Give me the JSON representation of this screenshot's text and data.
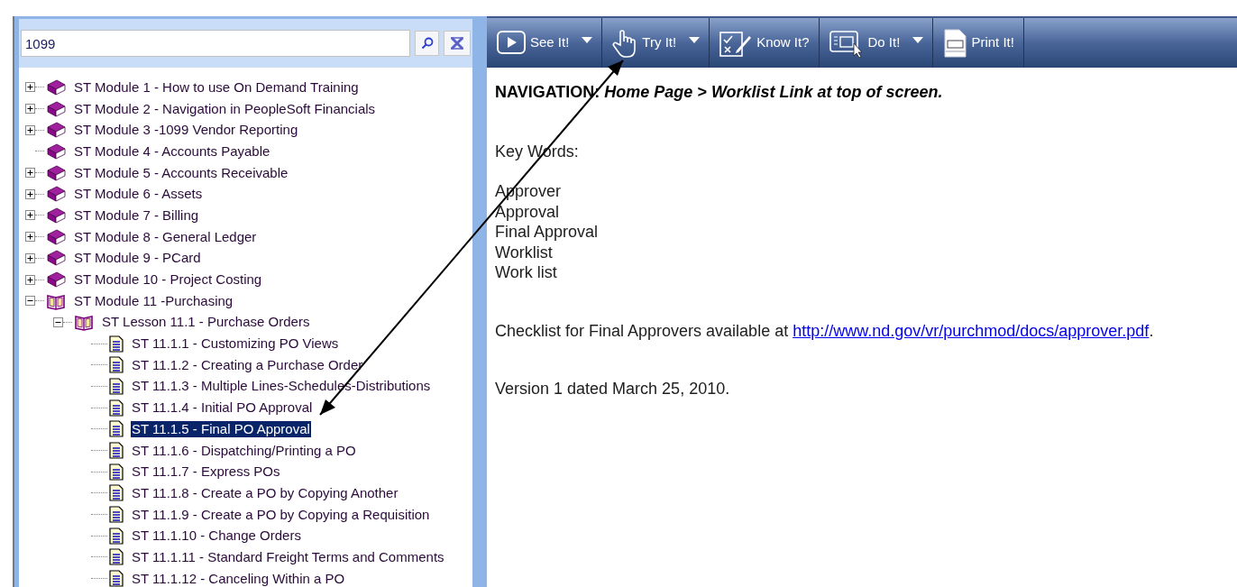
{
  "search": {
    "value": "1099"
  },
  "toolbar": {
    "buttons": [
      {
        "kind": "see",
        "label": "See It!",
        "has_menu": true
      },
      {
        "kind": "try",
        "label": "Try It!",
        "has_menu": true
      },
      {
        "kind": "know",
        "label": "Know It?",
        "has_menu": false
      },
      {
        "kind": "do",
        "label": "Do It!",
        "has_menu": true
      },
      {
        "kind": "print",
        "label": "Print It!",
        "has_menu": false
      }
    ]
  },
  "tree": [
    {
      "kind": "book",
      "label": "ST Module 1 - How to use On Demand Training",
      "expandable": true,
      "expanded": false
    },
    {
      "kind": "book",
      "label": "ST Module 2 - Navigation in PeopleSoft Financials",
      "expandable": true,
      "expanded": false
    },
    {
      "kind": "book",
      "label": "ST Module 3 -1099 Vendor Reporting",
      "expandable": true,
      "expanded": false
    },
    {
      "kind": "book",
      "label": "ST Module 4 - Accounts Payable",
      "expandable": false,
      "expanded": false
    },
    {
      "kind": "book",
      "label": "ST Module 5 - Accounts Receivable",
      "expandable": true,
      "expanded": false
    },
    {
      "kind": "book",
      "label": "ST Module 6 - Assets",
      "expandable": true,
      "expanded": false
    },
    {
      "kind": "book",
      "label": "ST Module 7 - Billing",
      "expandable": true,
      "expanded": false
    },
    {
      "kind": "book",
      "label": "ST Module 8 - General Ledger",
      "expandable": true,
      "expanded": false
    },
    {
      "kind": "book",
      "label": "ST Module 9 - PCard",
      "expandable": true,
      "expanded": false
    },
    {
      "kind": "book",
      "label": "ST Module 10 - Project Costing",
      "expandable": true,
      "expanded": false
    },
    {
      "kind": "book",
      "label": "ST Module 11 -Purchasing",
      "expandable": true,
      "expanded": true,
      "children": [
        {
          "kind": "book",
          "label": "ST Lesson 11.1 - Purchase Orders",
          "expandable": true,
          "expanded": true,
          "children": [
            {
              "kind": "page",
              "label": "ST 11.1.1 - Customizing PO Views",
              "selected": false
            },
            {
              "kind": "page",
              "label": "ST 11.1.2 - Creating a Purchase Order",
              "selected": false
            },
            {
              "kind": "page",
              "label": "ST 11.1.3 - Multiple Lines-Schedules-Distributions",
              "selected": false
            },
            {
              "kind": "page",
              "label": "ST 11.1.4 - Initial PO Approval",
              "selected": false
            },
            {
              "kind": "page",
              "label": "ST 11.1.5 - Final PO Approval",
              "selected": true
            },
            {
              "kind": "page",
              "label": "ST 11.1.6 - Dispatching/Printing a PO",
              "selected": false
            },
            {
              "kind": "page",
              "label": "ST 11.1.7 - Express POs",
              "selected": false
            },
            {
              "kind": "page",
              "label": "ST 11.1.8 - Create a PO by Copying Another",
              "selected": false
            },
            {
              "kind": "page",
              "label": "ST 11.1.9 - Create a PO by Copying a Requisition",
              "selected": false
            },
            {
              "kind": "page",
              "label": "ST 11.1.10 - Change Orders",
              "selected": false
            },
            {
              "kind": "page",
              "label": "ST 11.1.11 - Standard Freight Terms and Comments",
              "selected": false
            },
            {
              "kind": "page",
              "label": "ST 11.1.12 - Canceling Within a PO",
              "selected": false
            }
          ]
        }
      ]
    }
  ],
  "content": {
    "navigation": "NAVIGATION: *Home Page > Worklist Link at top of screen.*",
    "keywords_heading": "Key Words:",
    "keywords": [
      "Approver",
      "Approval",
      "Final Approval",
      "Worklist",
      "Work list"
    ],
    "checklist": {
      "text": "Checklist for Final Approvers available at ",
      "link": "http://www.nd.gov/vr/purchmod/docs/approver.pdf",
      "after": "."
    },
    "version": "Version 1 dated March 25, 2010."
  }
}
